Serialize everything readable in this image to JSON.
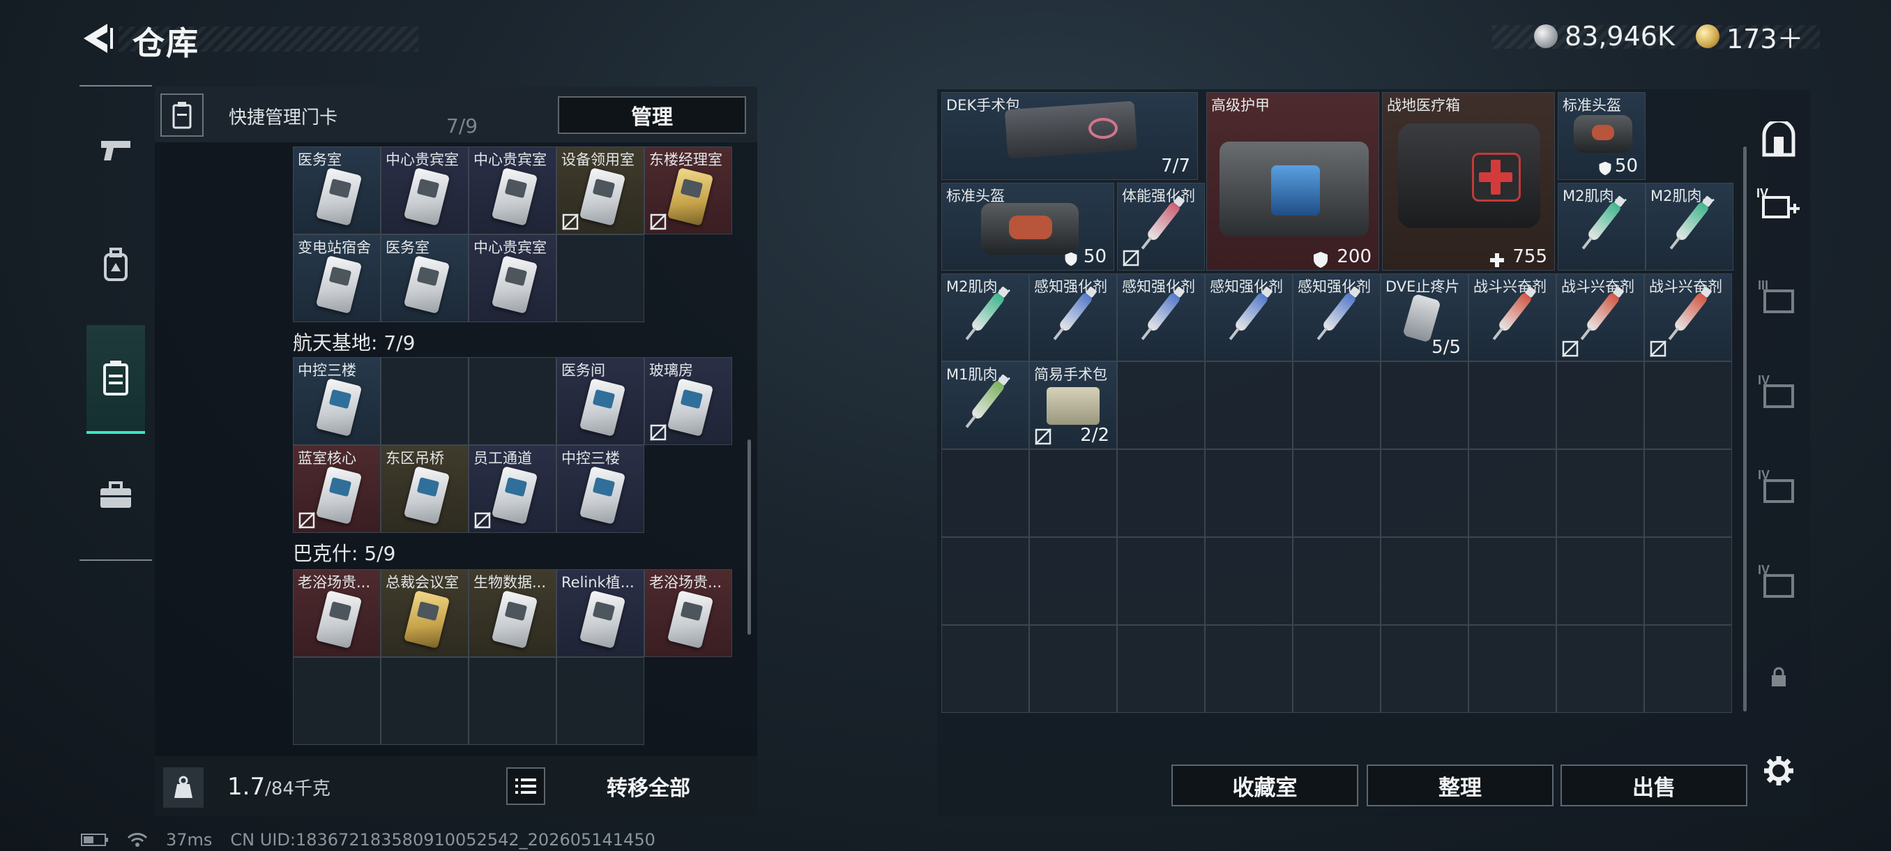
{
  "header": {
    "title": "仓库",
    "currency_silver": "83,946K",
    "currency_gold": "173＋"
  },
  "left_panel": {
    "title": "快捷管理门卡",
    "manage_label": "管理",
    "weight_value": "1.7",
    "weight_max": "/84千克",
    "transfer_label": "转移全部",
    "top_partial_section": "7/9",
    "row1": [
      "医务室",
      "中心贵宾室",
      "中心贵宾室",
      "设备领用室",
      "东楼经理室"
    ],
    "row2": [
      "变电站宿舍",
      "医务室",
      "中心贵宾室"
    ],
    "section2": "航天基地: 7/9",
    "row3": [
      "中控三楼",
      "",
      "",
      "医务间",
      "玻璃房"
    ],
    "row4": [
      "蓝室核心",
      "东区吊桥",
      "员工通道",
      "中控三楼"
    ],
    "section3": "巴克什: 5/9",
    "row5": [
      "老浴场贵...",
      "总裁会议室",
      "生物数据...",
      "Relink植...",
      "老浴场贵..."
    ]
  },
  "right_panel": {
    "items": {
      "dek": "DEK手术包",
      "dek_count": "7/7",
      "armor": "高级护甲",
      "armor_val": "200",
      "medkit": "战地医疗箱",
      "medkit_val": "755",
      "helmet1": "标准头盔",
      "helmet1_val": "50",
      "helmet2": "标准头盔",
      "helmet2_val": "50",
      "stamina": "体能强化剂",
      "m2a": "M2肌肉...",
      "m2b": "M2肌肉...",
      "m2c": "M2肌肉...",
      "perc1": "感知强化剂",
      "perc2": "感知强化剂",
      "perc3": "感知强化剂",
      "perc4": "感知强化剂",
      "dve": "DVE止疼片",
      "dve_count": "5/5",
      "combat1": "战斗兴奋剂",
      "combat2": "战斗兴奋剂",
      "combat3": "战斗兴奋剂",
      "m1": "M1肌肉...",
      "simple": "简易手术包",
      "simple_count": "2/2"
    },
    "buttons": {
      "collection": "收藏室",
      "organize": "整理",
      "sell": "出售"
    }
  },
  "status_bar": {
    "ping": "37ms",
    "uid": "CN UID:18367218358091005254​2_202605141450"
  },
  "colors": {
    "accent": "#39e6c0",
    "panel": "#151c22"
  }
}
